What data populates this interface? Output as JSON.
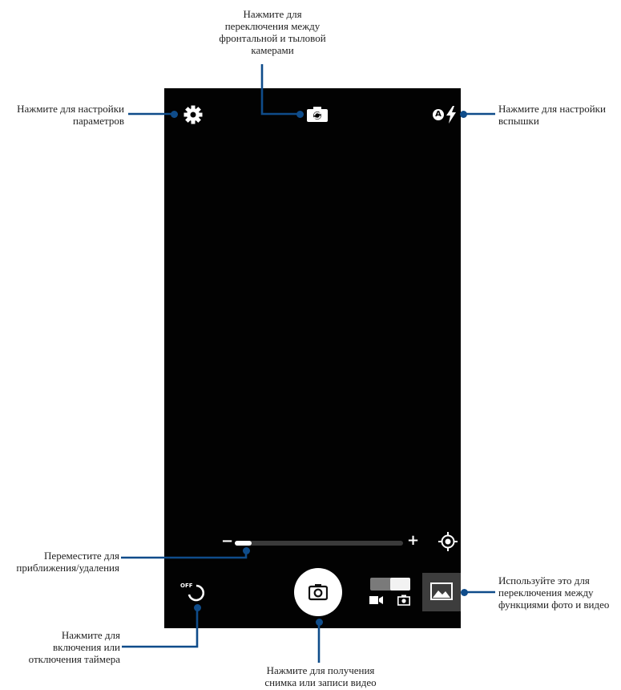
{
  "callouts": {
    "switch_camera": "Нажмите для\nпереключения между\nфронтальной и тыловой\nкамерами",
    "settings": "Нажмите для настройки\nпараметров",
    "flash": "Нажмите для настройки\nвспышки",
    "zoom": "Переместите для\nприближения/удаления",
    "mode_switch": "Используйте это для\nпереключения между\nфункциями фото и видео",
    "timer": "Нажмите для\nвключения или\nотключения таймера",
    "shutter": "Нажмите для получения\nснимка или записи видео"
  },
  "camera": {
    "timer_label": "OFF",
    "flash_mode_label": "A",
    "zoom_minus": "−",
    "zoom_plus": "+",
    "zoom_level": 0.1
  },
  "icons": {
    "settings": "gear-icon",
    "switch_camera": "camera-switch-icon",
    "flash": "flash-auto-icon",
    "focus": "focus-target-icon",
    "timer": "timer-icon",
    "shutter": "camera-icon",
    "video_mode": "video-camera-icon",
    "photo_mode": "photo-camera-icon",
    "gallery": "gallery-image-icon"
  },
  "colors": {
    "callout_line": "#0f4c8a",
    "viewfinder": "#020202",
    "controls": "#ffffff"
  }
}
